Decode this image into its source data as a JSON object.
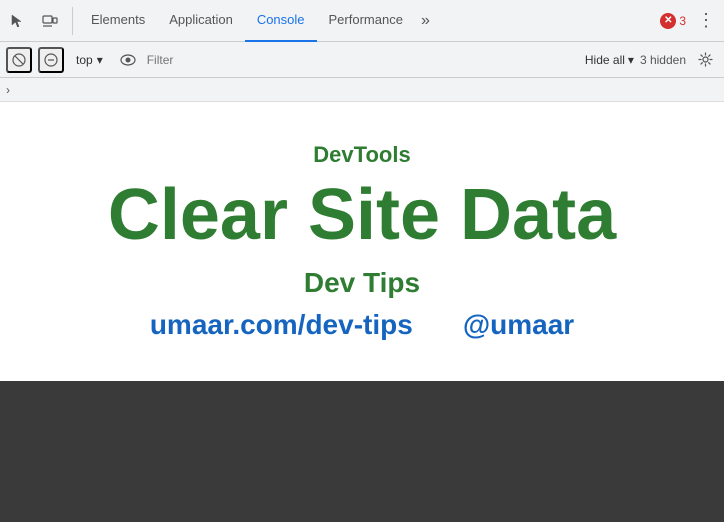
{
  "toolbar": {
    "icons": [
      {
        "name": "cursor-icon",
        "symbol": "↖",
        "label": "Select element"
      },
      {
        "name": "device-icon",
        "symbol": "⬜",
        "label": "Toggle device toolbar"
      }
    ],
    "tabs": [
      {
        "id": "elements",
        "label": "Elements",
        "active": false
      },
      {
        "id": "application",
        "label": "Application",
        "active": false
      },
      {
        "id": "console",
        "label": "Console",
        "active": true
      },
      {
        "id": "performance",
        "label": "Performance",
        "active": false
      }
    ],
    "overflow_symbol": "»",
    "error_count": "3",
    "menu_symbol": "⋮"
  },
  "toolbar2": {
    "play_symbol": "▶",
    "stop_symbol": "⊘",
    "context_label": "top",
    "dropdown_symbol": "▾",
    "eye_symbol": "👁",
    "filter_placeholder": "Filter",
    "hide_all_label": "Hide all",
    "hide_dropdown": "▾",
    "hidden_count": "3 hidden",
    "gear_symbol": "⚙"
  },
  "sidebar_row": {
    "chevron": "›"
  },
  "panel": {
    "devtools_label": "DevTools",
    "main_title": "Clear Site Data",
    "subtitle": "Dev Tips",
    "link1": "umaar.com/dev-tips",
    "link2": "@umaar"
  }
}
